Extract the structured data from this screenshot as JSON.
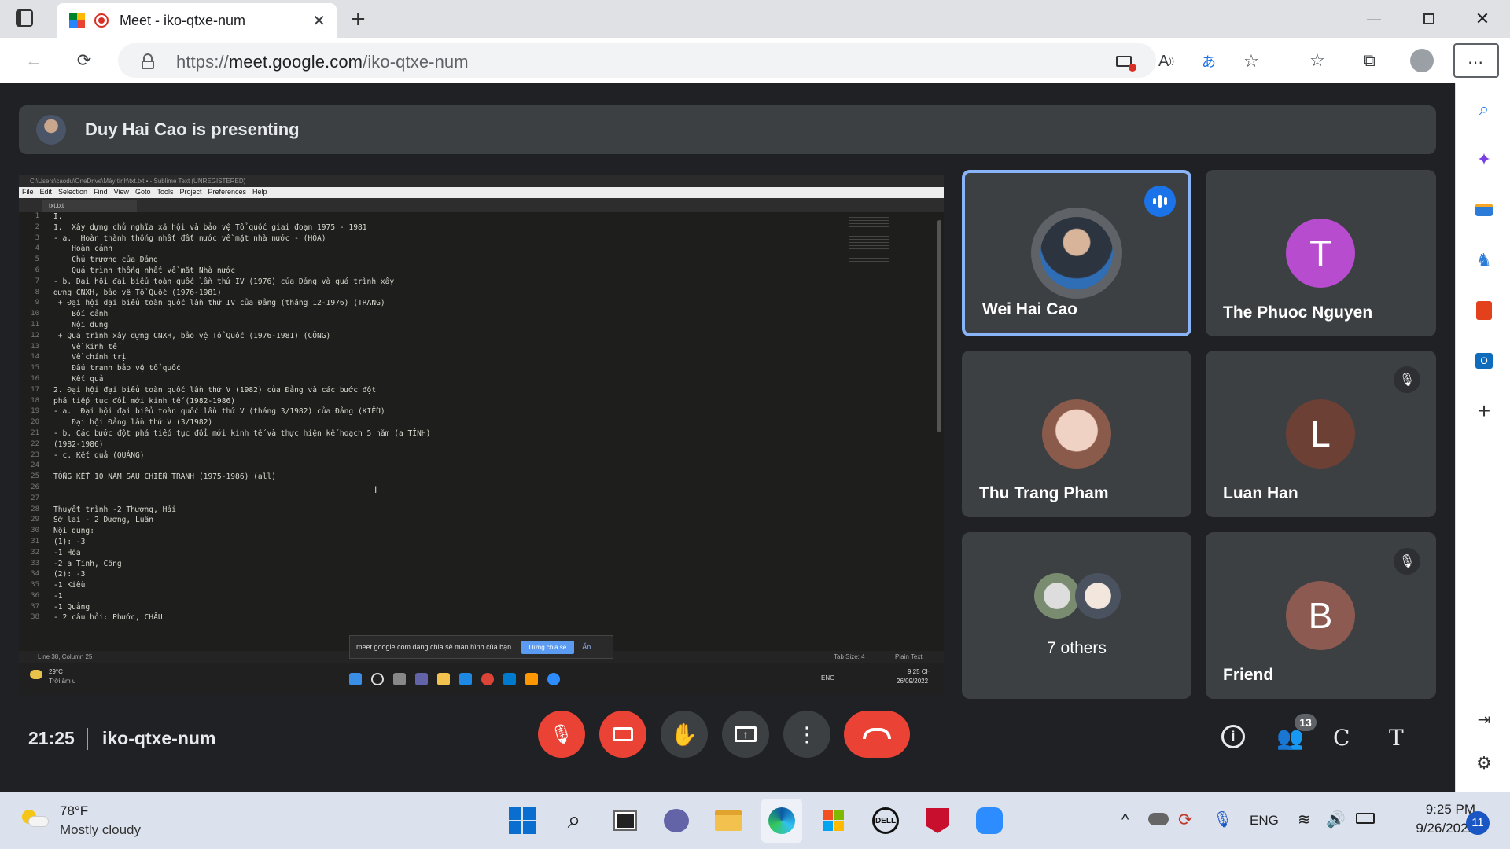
{
  "browser": {
    "tab_title": "Meet - iko-qtxe-num",
    "url_host": "meet.google.com",
    "url_path": "/iko-qtxe-num",
    "url_scheme": "https://"
  },
  "meet": {
    "presenting_text": "Duy Hai Cao is presenting",
    "time": "21:25",
    "meeting_code": "iko-qtxe-num",
    "participant_count": "13",
    "extra_buttons": [
      "C",
      "T"
    ]
  },
  "tiles": [
    {
      "name": "Wei Hai Cao",
      "initial": "",
      "color": "#3c4043",
      "speaking": true
    },
    {
      "name": "The Phuoc Nguyen",
      "initial": "T",
      "color": "#b84ccf"
    },
    {
      "name": "Thu Trang Pham",
      "initial": "",
      "color": "#d8a89a"
    },
    {
      "name": "Luan Han",
      "initial": "L",
      "color": "#6d4035"
    },
    {
      "name": "7 others",
      "initial": "",
      "color": "#3c4043"
    },
    {
      "name": "Friend",
      "initial": "B",
      "color": "#8c5a50"
    }
  ],
  "shared_screen": {
    "window_title": "C:\\Users\\caodu\\OneDrive\\Máy tính\\txt.txt • - Sublime Text (UNREGISTERED)",
    "menu": [
      "File",
      "Edit",
      "Selection",
      "Find",
      "View",
      "Goto",
      "Tools",
      "Project",
      "Preferences",
      "Help"
    ],
    "file_tab": "txt.txt",
    "lines": [
      "I.",
      "1.  Xây dựng chủ nghĩa xã hội và bảo vệ Tổ quốc giai đoạn 1975 - 1981",
      "- a.  Hoàn thành thống nhất đất nước về mặt nhà nước - (HÒA)",
      "    Hoàn cảnh",
      "    Chủ trương của Đảng",
      "    Quá trình thống nhất về mặt Nhà nước",
      "- b. Đại hội đại biểu toàn quốc lần thứ IV (1976) của Đảng và quá trình xây",
      "dựng CNXH, bảo vệ Tổ Quốc (1976-1981)",
      " + Đại hội đại biểu toàn quốc lần thứ IV của Đảng (tháng 12-1976) (TRANG)",
      "    Bối cảnh",
      "    Nội dung",
      " + Quá trình xây dựng CNXH, bảo vệ Tổ Quốc (1976-1981) (CÔNG)",
      "    Về kinh tế",
      "    Về chính trị",
      "    Đấu tranh bảo vệ tổ quốc",
      "    Kết quả",
      "2. Đại hội đại biểu toàn quốc lần thứ V (1982) của Đảng và các bước đột",
      "phá tiếp tục đổi mới kinh tế (1982-1986)",
      "- a.  Đại hội đại biểu toàn quốc lần thứ V (tháng 3/1982) của Đảng (KIỀU)",
      "    Đại hội Đảng lần thứ V (3/1982)",
      "- b. Các bước đột phá tiếp tục đổi mới kinh tế và thực hiện kế hoạch 5 năm (a TÍNH)",
      "(1982-1986)",
      "- c. Kết quả (QUẢNG)",
      "",
      "TỔNG KẾT 10 NĂM SAU CHIẾN TRANH (1975-1986) (all)",
      "",
      "",
      "Thuyết trình -2 Thương, Hải",
      "Sờ lai - 2 Dương, Luân",
      "Nội dung:",
      "(1): -3",
      "-1 Hòa",
      "-2 a Tính, Công",
      "(2): -3",
      "-1 Kiều",
      "-1",
      "-1 Quảng",
      "- 2 câu hỏi: Phước, CHÂU"
    ],
    "status_left": "Line 38, Column 25",
    "status_tab": "Tab Size: 4",
    "status_syntax": "Plain Text",
    "share_notice": "meet.google.com đang chia sẻ màn hình của bạn.",
    "share_stop": "Dừng chia sẻ",
    "share_hide": "Ẩn",
    "task_weather_temp": "29°C",
    "task_weather_desc": "Trời ấm u",
    "task_lang": "ENG",
    "task_time": "9:25 CH",
    "task_date": "26/09/2022"
  },
  "taskbar": {
    "weather_temp": "78°F",
    "weather_desc": "Mostly cloudy",
    "lang": "ENG",
    "time": "9:25 PM",
    "date": "9/26/2022",
    "notifications": "11"
  },
  "colors": {
    "meet_bg": "#202124",
    "tile_bg": "#3c4043",
    "danger": "#ea4335",
    "active_border": "#8ab4f8"
  }
}
